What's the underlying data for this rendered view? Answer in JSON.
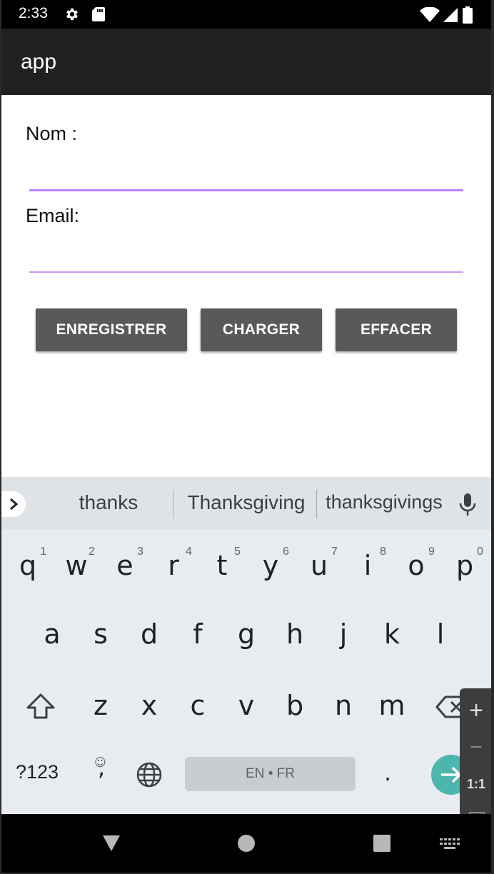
{
  "status_bar": {
    "time": "2:33",
    "icons": [
      "gear-icon",
      "sd-card-icon",
      "wifi-icon",
      "signal-icon",
      "battery-icon"
    ]
  },
  "app_bar": {
    "title": "app"
  },
  "form": {
    "nom_label": "Nom :",
    "nom_value": "",
    "email_label": "Email:",
    "email_value": "",
    "accent_color": "#bb86fc"
  },
  "buttons": {
    "save": "ENREGISTRER",
    "load": "CHARGER",
    "clear": "EFFACER",
    "color": "#595959"
  },
  "keyboard": {
    "suggestions": [
      "thanks",
      "Thanksgiving",
      "thanksgivings"
    ],
    "row1": [
      {
        "key": "q",
        "hint": "1"
      },
      {
        "key": "w",
        "hint": "2"
      },
      {
        "key": "e",
        "hint": "3"
      },
      {
        "key": "r",
        "hint": "4"
      },
      {
        "key": "t",
        "hint": "5"
      },
      {
        "key": "y",
        "hint": "6"
      },
      {
        "key": "u",
        "hint": "7"
      },
      {
        "key": "i",
        "hint": "8"
      },
      {
        "key": "o",
        "hint": "9"
      },
      {
        "key": "p",
        "hint": "0"
      }
    ],
    "row2": [
      "a",
      "s",
      "d",
      "f",
      "g",
      "h",
      "j",
      "k",
      "l"
    ],
    "row3": [
      "z",
      "x",
      "c",
      "v",
      "b",
      "n",
      "m"
    ],
    "symbols_key": "?123",
    "comma_key": ",",
    "emoji_hint": "☺",
    "space_label": "EN • FR",
    "period_key": ".",
    "enter_color": "#4db6ac"
  },
  "zoom_panel": {
    "zoom_in": "+",
    "zoom_out": "−",
    "actual_size": "1:1"
  },
  "nav_bar": {
    "icons": [
      "back-icon",
      "home-icon",
      "recents-icon",
      "keyboard-icon"
    ]
  }
}
